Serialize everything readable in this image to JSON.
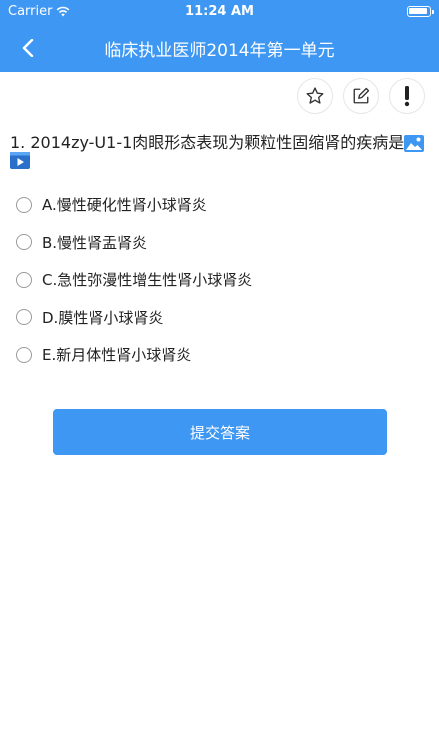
{
  "status_bar": {
    "carrier": "Carrier",
    "time": "11:24 AM"
  },
  "nav": {
    "title": "临床执业医师2014年第一单元",
    "back_icon": "chevron-left-icon"
  },
  "toolbar": {
    "items": [
      {
        "icon": "star-icon"
      },
      {
        "icon": "edit-note-icon"
      },
      {
        "icon": "exclamation-icon"
      }
    ]
  },
  "question": {
    "text": "1. 2014zy-U1-1肉眼形态表现为颗粒性固缩肾的疾病是",
    "image_icon": "image-icon",
    "video_icon": "video-play-icon"
  },
  "options": [
    {
      "label": "A.慢性硬化性肾小球肾炎",
      "selected": false
    },
    {
      "label": "B.慢性肾盂肾炎",
      "selected": false
    },
    {
      "label": "C.急性弥漫性增生性肾小球肾炎",
      "selected": false
    },
    {
      "label": "D.膜性肾小球肾炎",
      "selected": false
    },
    {
      "label": "E.新月体性肾小球肾炎",
      "selected": false
    }
  ],
  "submit": {
    "label": "提交答案"
  },
  "colors": {
    "primary": "#3e97f2",
    "text": "#222222",
    "white": "#ffffff"
  }
}
